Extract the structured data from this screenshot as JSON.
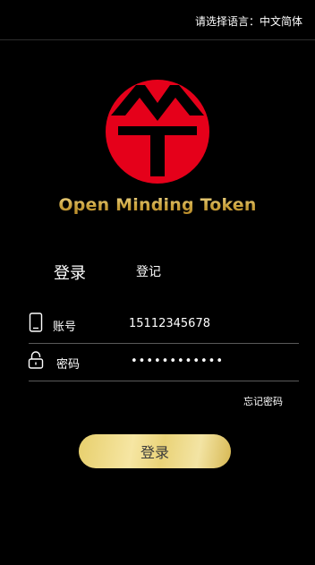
{
  "header": {
    "language_selector": "请选择语言：中文简体"
  },
  "brand": {
    "name": "Open Minding Token",
    "logo_colors": {
      "circle": "#e5001a",
      "mark": "#000000"
    },
    "text_color": "#d7b65a"
  },
  "tabs": [
    {
      "label": "登录",
      "active": true
    },
    {
      "label": "登记",
      "active": false
    }
  ],
  "form": {
    "account": {
      "icon": "phone-icon",
      "label": "账号",
      "value": "15112345678"
    },
    "password": {
      "icon": "lock-icon",
      "label": "密码",
      "value": "••••••••••••"
    },
    "forgot_label": "忘记密码",
    "submit_label": "登录"
  },
  "colors": {
    "background": "#000000",
    "divider": "#5a5a5a",
    "button_gold": "#ead378"
  }
}
